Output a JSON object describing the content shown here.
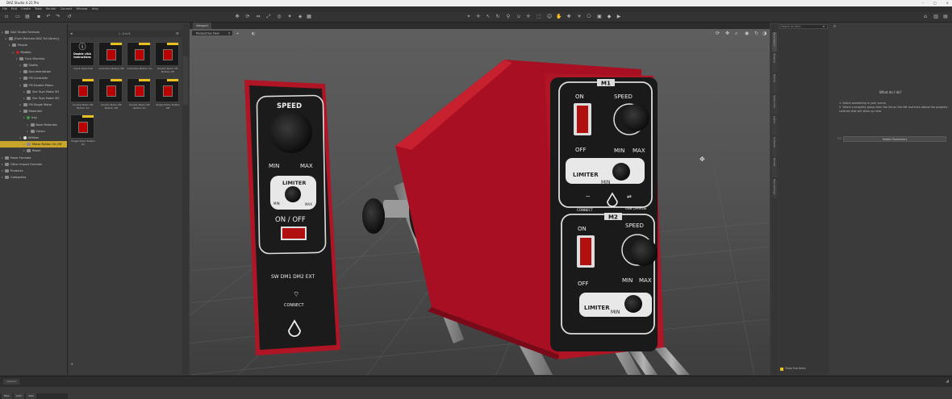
{
  "window": {
    "title": "DAZ Studio 4.21 Pro"
  },
  "menu": [
    "File",
    "Edit",
    "Create",
    "Tools",
    "Render",
    "Connect",
    "Window",
    "Help"
  ],
  "content_library": {
    "tab": "DAZ Studio Formats",
    "items": [
      {
        "label": "DAZ Studio Formats",
        "indent": 0,
        "icon": "folder"
      },
      {
        "label": "[Fuck Machine DAZ 3d Library]",
        "indent": 1,
        "icon": "folder"
      },
      {
        "label": "People",
        "indent": 2,
        "icon": "folder"
      },
      {
        "label": "Moddie",
        "indent": 3,
        "icon": "red"
      },
      {
        "label": "Fuck Machine",
        "indent": 4,
        "icon": "folder"
      },
      {
        "label": "Shafts",
        "indent": 5,
        "icon": "gear"
      },
      {
        "label": "Documentation",
        "indent": 5,
        "icon": "gear"
      },
      {
        "label": "FM Controller",
        "indent": 5,
        "icon": "folder"
      },
      {
        "label": "FM Double Motor",
        "indent": 5,
        "icon": "folder"
      },
      {
        "label": "Sex Toys Motor M1",
        "indent": 6,
        "icon": "folder"
      },
      {
        "label": "Sex Toys Motor M2",
        "indent": 6,
        "icon": "folder"
      },
      {
        "label": "FM Single Motor",
        "indent": 5,
        "icon": "folder"
      },
      {
        "label": "Materials",
        "indent": 5,
        "icon": "gear"
      },
      {
        "label": "Iray",
        "indent": 6,
        "icon": "green"
      },
      {
        "label": "Base Materials",
        "indent": 7,
        "icon": "folder"
      },
      {
        "label": "Colors",
        "indent": 7,
        "icon": "folder"
      },
      {
        "label": "Utilities",
        "indent": 5,
        "icon": "white"
      },
      {
        "label": "Motor Button On Off",
        "indent": 6,
        "icon": "folder",
        "selected": true
      },
      {
        "label": "Reset",
        "indent": 6,
        "icon": "folder"
      },
      {
        "label": "Poser Formats",
        "indent": 0,
        "icon": "folder"
      },
      {
        "label": "Other Import Formats",
        "indent": 0,
        "icon": "folder"
      },
      {
        "label": "Products",
        "indent": 0,
        "icon": "folder"
      },
      {
        "label": "Categories",
        "indent": 0,
        "icon": "folder"
      }
    ],
    "bottom_tabs": [
      "Files",
      "Anim",
      "Sets"
    ]
  },
  "browser": {
    "page": "1 - 8 of 8",
    "thumbs": [
      {
        "caption": "!Click Here First",
        "kind": "info",
        "label": "Double click Instructions"
      },
      {
        "caption": "Controller Button Off",
        "kind": "switch"
      },
      {
        "caption": "Controller Button On",
        "kind": "switch"
      },
      {
        "caption": "Double Motor M1 Button Off",
        "kind": "switch"
      },
      {
        "caption": "Double Motor M1 Button On",
        "kind": "switch"
      },
      {
        "caption": "Double Motor M2 Button Off",
        "kind": "switch"
      },
      {
        "caption": "Double Motor M2 Button On",
        "kind": "switch"
      },
      {
        "caption": "Single Motor Button Off",
        "kind": "switch"
      },
      {
        "caption": "Single Motor Button On",
        "kind": "switch"
      }
    ]
  },
  "viewport": {
    "tab": "Viewport",
    "view": "Perspective View",
    "controller": {
      "speed": "SPEED",
      "min": "MIN",
      "max": "MAX",
      "limiter": "LIMITER",
      "lim_min": "MIN",
      "lim_max": "MAX",
      "onoff": "ON / OFF",
      "modes": "SW DM1 DM2 EXT",
      "connect": "CONNECT"
    },
    "motor1": {
      "label": "M1",
      "on": "ON",
      "off": "OFF",
      "speed": "SPEED",
      "min": "MIN",
      "max": "MAX",
      "limiter": "LIMITER",
      "lim_min": "MIN",
      "connect": "CONNECT",
      "usb": "USB CHARGE"
    },
    "motor2": {
      "label": "M2",
      "on": "ON",
      "off": "OFF",
      "speed": "SPEED",
      "min": "MIN",
      "max": "MAX",
      "limiter": "LIMITER",
      "lim_min": "MIN"
    }
  },
  "right_panel": {
    "search": "Search on term",
    "heading": "What do I do?",
    "steps": [
      "1. Select something in your scene.",
      "2. Select a property group from the list on the left and then adjust the property controls that will show up here."
    ],
    "button": "Hidden Parameters",
    "footer": "Show Sub Items",
    "side_tabs": [
      "Parameters",
      "Shaping",
      "Posing",
      "Scene Info",
      "Lights",
      "Surfaces",
      "Render",
      "Tool Settings"
    ]
  },
  "status": {
    "chip": "Lessons"
  }
}
